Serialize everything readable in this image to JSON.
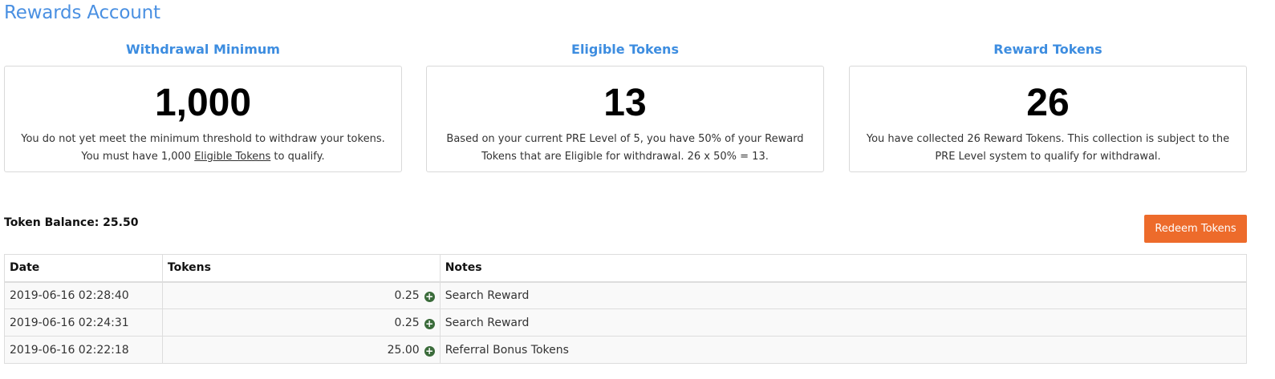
{
  "page": {
    "title": "Rewards Account"
  },
  "stats": [
    {
      "heading": "Withdrawal Minimum",
      "value": "1,000",
      "desc_pre": "You do not yet meet the minimum threshold to withdraw your tokens. You must have 1,000 ",
      "desc_link": "Eligible Tokens",
      "desc_post": " to qualify."
    },
    {
      "heading": "Eligible Tokens",
      "value": "13",
      "desc": "Based on your current PRE Level of 5, you have 50% of your Reward Tokens that are Eligible for withdrawal. 26 x 50% = 13."
    },
    {
      "heading": "Reward Tokens",
      "value": "26",
      "desc": "You have collected 26 Reward Tokens. This collection is subject to the PRE Level system to qualify for withdrawal."
    }
  ],
  "balance": {
    "text": "Token Balance: 25.50"
  },
  "redeem_button": {
    "label": "Redeem Tokens"
  },
  "colors": {
    "accent": "#4a90e2",
    "button": "#ed6b2b",
    "plus_icon": "#3a6b3a"
  },
  "table": {
    "headers": {
      "date": "Date",
      "tokens": "Tokens",
      "notes": "Notes"
    },
    "rows": [
      {
        "date": "2019-06-16 02:28:40",
        "tokens": "0.25",
        "icon": "plus-circle-icon",
        "notes": "Search Reward"
      },
      {
        "date": "2019-06-16 02:24:31",
        "tokens": "0.25",
        "icon": "plus-circle-icon",
        "notes": "Search Reward"
      },
      {
        "date": "2019-06-16 02:22:18",
        "tokens": "25.00",
        "icon": "plus-circle-icon",
        "notes": "Referral Bonus Tokens"
      }
    ]
  }
}
